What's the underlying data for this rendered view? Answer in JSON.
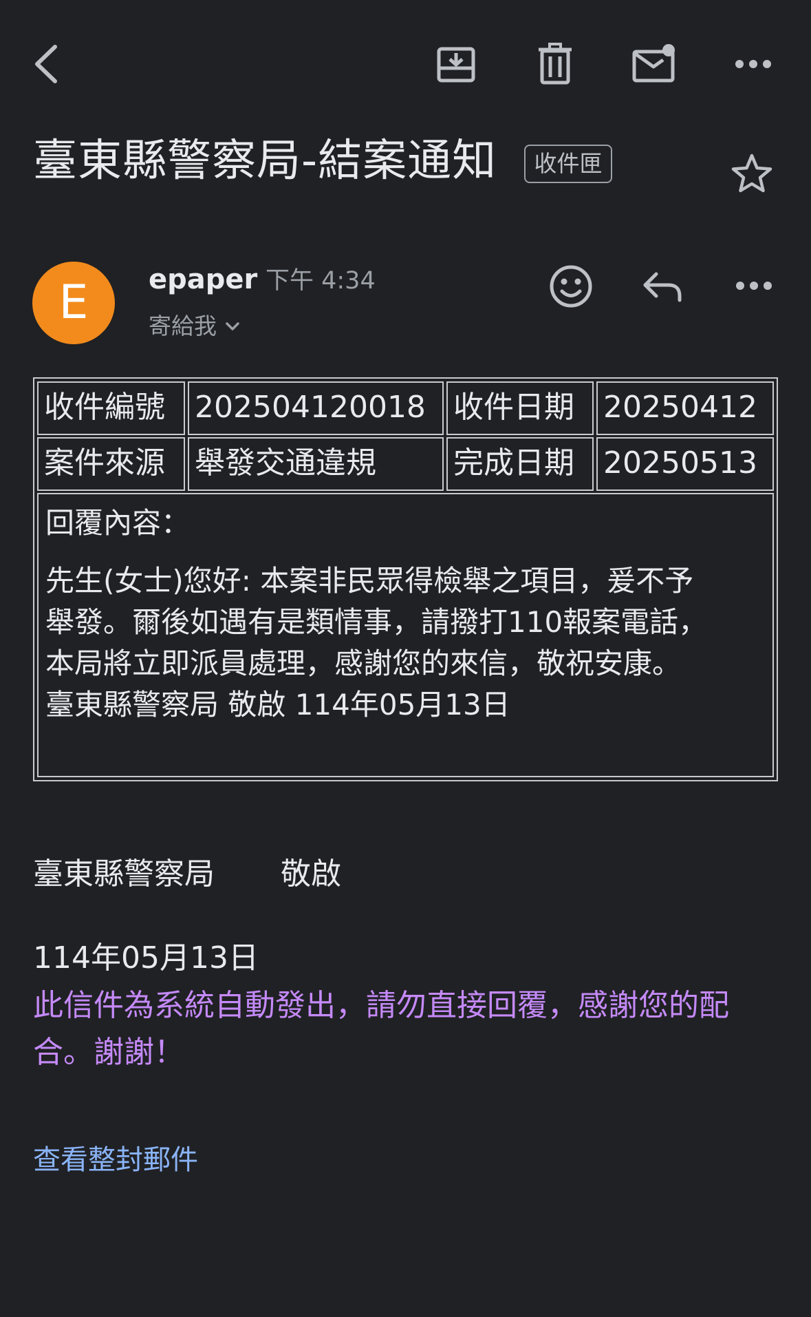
{
  "toolbar": {
    "back_icon": "chevron-left-icon",
    "archive_icon": "archive-icon",
    "delete_icon": "trash-icon",
    "mark_unread_icon": "mail-unread-icon",
    "more_icon": "more-horizontal-icon"
  },
  "subject": {
    "title": "臺東縣警察局-結案通知",
    "label": "收件匣",
    "star_icon": "star-icon"
  },
  "sender": {
    "avatar_letter": "E",
    "avatar_color": "#f28b1c",
    "name": "epaper",
    "time": "下午 4:34",
    "to": "寄給我",
    "react_icon": "emoji-icon",
    "reply_icon": "reply-icon",
    "more_icon": "more-horizontal-icon"
  },
  "table": {
    "row1": {
      "label1": "收件編號",
      "value1": "202504120018",
      "label2": "收件日期",
      "value2": "20250412"
    },
    "row2": {
      "label1": "案件來源",
      "value1": "舉發交通違規",
      "label2": "完成日期",
      "value2": "20250513"
    },
    "reply_label": "回覆內容：",
    "reply_lines": [
      "先生(女士)您好: 本案非民眾得檢舉之項目，爰不予",
      "舉發。爾後如遇有是類情事，請撥打110報案電話，",
      "本局將立即派員處理，感謝您的來信，敬祝安康。",
      "臺東縣警察局 敬啟 114年05月13日"
    ]
  },
  "signature": {
    "org": "臺東縣警察局",
    "closing": "敬啟",
    "date": "114年05月13日"
  },
  "auto_note": "此信件為系統自動發出，請勿直接回覆，感謝您的配合。謝謝！",
  "view_all": "查看整封郵件",
  "colors": {
    "background": "#202124",
    "note": "#c58af9",
    "link": "#8ab4f8"
  }
}
